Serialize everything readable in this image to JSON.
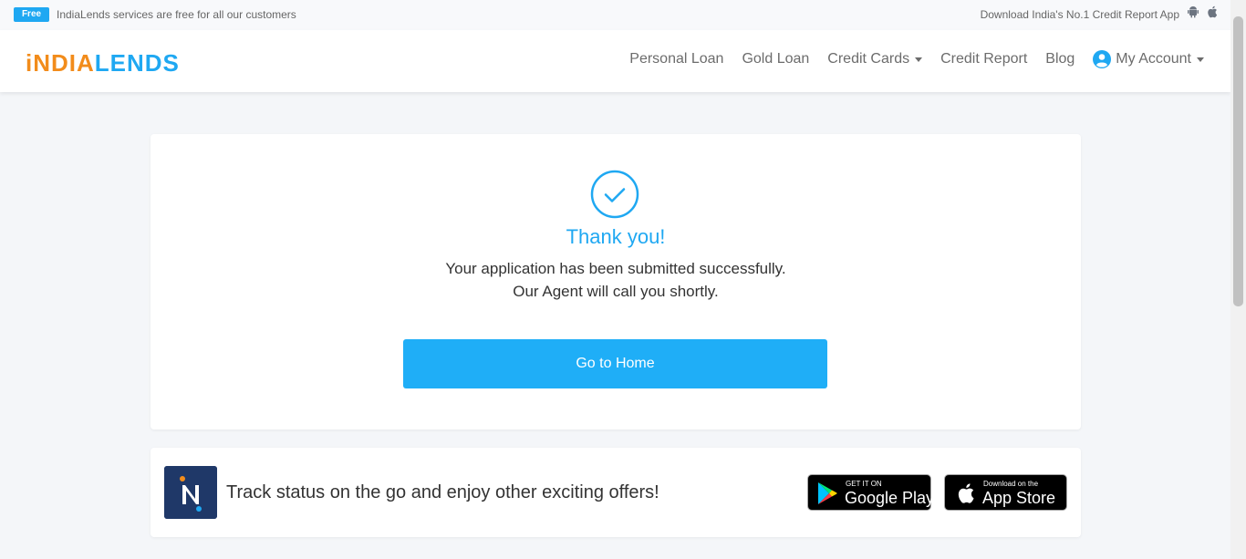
{
  "topbar": {
    "badge": "Free",
    "message": "IndiaLends services are free for all our customers",
    "download_text": "Download India's No.1 Credit Report App",
    "icons": [
      "android-icon",
      "apple-icon"
    ]
  },
  "header": {
    "logo_left": "iNDIA",
    "logo_right": "LENDS",
    "nav": {
      "personal_loan": "Personal Loan",
      "gold_loan": "Gold Loan",
      "credit_cards": "Credit Cards",
      "credit_report": "Credit Report",
      "blog": "Blog",
      "my_account": "My Account"
    }
  },
  "confirmation": {
    "title": "Thank you!",
    "line1": "Your application has been submitted successfully.",
    "line2": "Our Agent will call you shortly.",
    "button": "Go to Home"
  },
  "promo": {
    "text": "Track status on the go and enjoy other exciting offers!",
    "google_play_small": "GET IT ON",
    "google_play_big": "Google Play",
    "app_store_small": "Download on the",
    "app_store_big": "App Store"
  },
  "colors": {
    "accent": "#1fa8f2",
    "logo_orange": "#f28c1b",
    "app_icon_bg": "#1f3868"
  }
}
